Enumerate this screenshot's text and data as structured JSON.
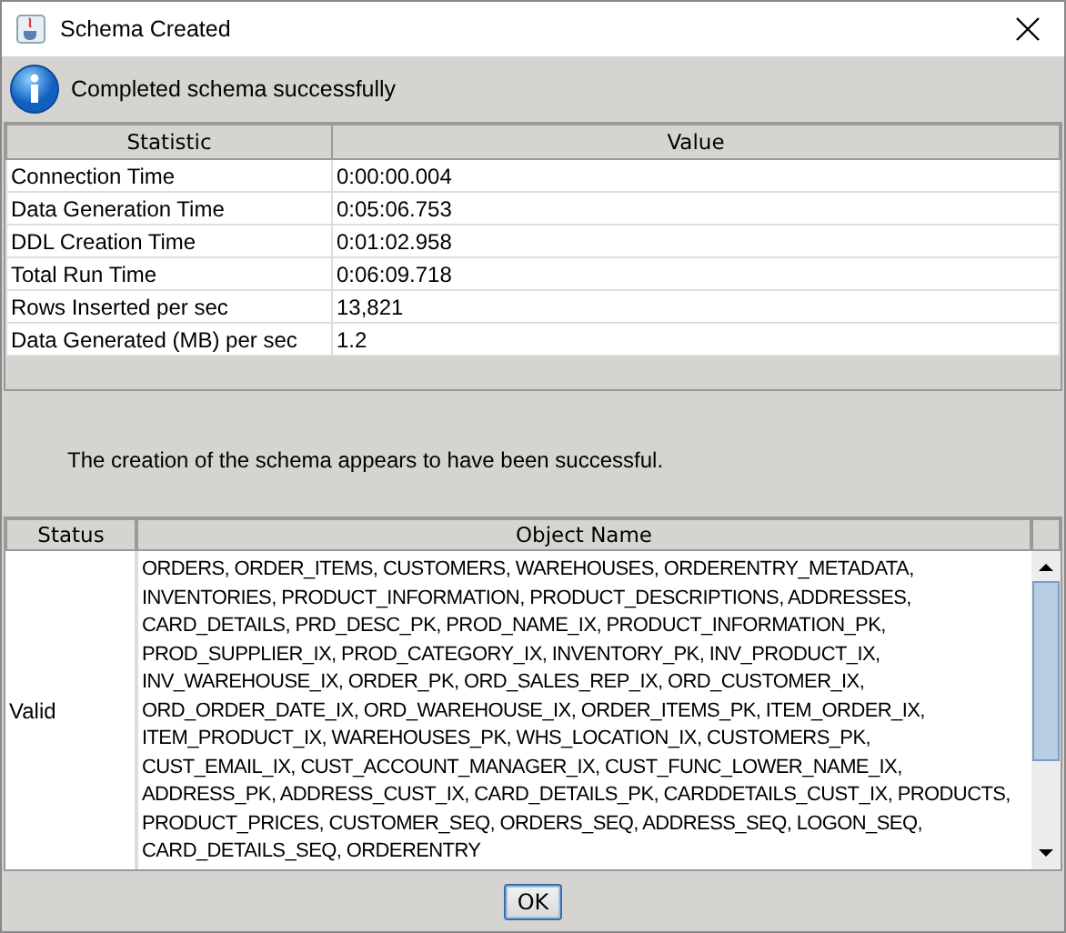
{
  "window": {
    "title": "Schema Created"
  },
  "info": {
    "message": "Completed schema successfully"
  },
  "stats_table": {
    "columns": [
      "Statistic",
      "Value"
    ],
    "rows": [
      {
        "statistic": "Connection Time",
        "value": "0:00:00.004"
      },
      {
        "statistic": "Data Generation Time",
        "value": "0:05:06.753"
      },
      {
        "statistic": "DDL Creation Time",
        "value": "0:01:02.958"
      },
      {
        "statistic": "Total Run Time",
        "value": "0:06:09.718"
      },
      {
        "statistic": "Rows Inserted per sec",
        "value": "13,821"
      },
      {
        "statistic": "Data Generated (MB) per sec",
        "value": "1.2"
      }
    ]
  },
  "result_message": "The creation of the schema appears to have been successful.",
  "objects_table": {
    "columns": [
      "Status",
      "Object Name"
    ],
    "rows": [
      {
        "status": "Valid",
        "object_lines": [
          "ORDERS, ORDER_ITEMS, CUSTOMERS, WAREHOUSES, ORDERENTRY_METADATA,",
          "INVENTORIES, PRODUCT_INFORMATION, PRODUCT_DESCRIPTIONS, ADDRESSES,",
          "CARD_DETAILS, PRD_DESC_PK, PROD_NAME_IX, PRODUCT_INFORMATION_PK,",
          "PROD_SUPPLIER_IX, PROD_CATEGORY_IX, INVENTORY_PK, INV_PRODUCT_IX,",
          "INV_WAREHOUSE_IX, ORDER_PK, ORD_SALES_REP_IX, ORD_CUSTOMER_IX,",
          "ORD_ORDER_DATE_IX, ORD_WAREHOUSE_IX, ORDER_ITEMS_PK, ITEM_ORDER_IX,",
          "ITEM_PRODUCT_IX, WAREHOUSES_PK, WHS_LOCATION_IX, CUSTOMERS_PK,",
          "CUST_EMAIL_IX, CUST_ACCOUNT_MANAGER_IX, CUST_FUNC_LOWER_NAME_IX,",
          "ADDRESS_PK, ADDRESS_CUST_IX, CARD_DETAILS_PK, CARDDETAILS_CUST_IX, PRODUCTS,",
          "PRODUCT_PRICES, CUSTOMER_SEQ, ORDERS_SEQ, ADDRESS_SEQ, LOGON_SEQ,",
          "CARD_DETAILS_SEQ, ORDERENTRY"
        ]
      }
    ]
  },
  "buttons": [
    "OK"
  ]
}
